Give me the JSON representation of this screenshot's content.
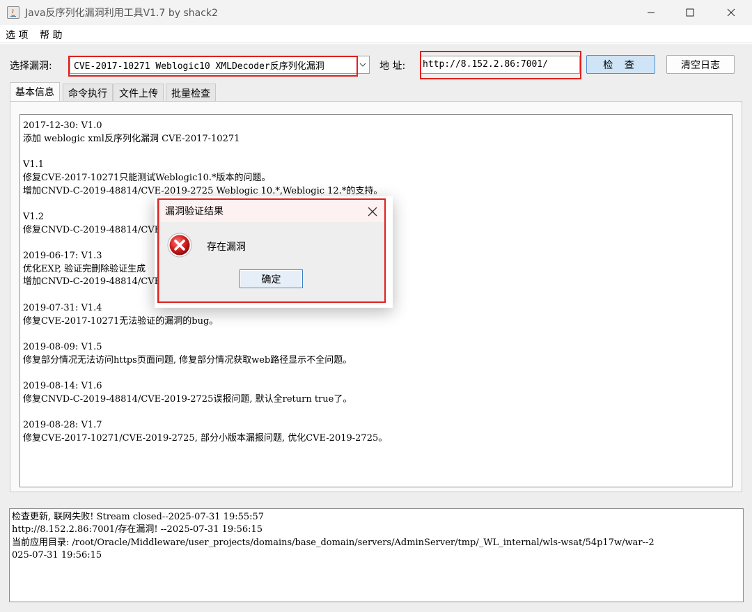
{
  "window": {
    "title": "Java反序列化漏洞利用工具V1.7 by shack2"
  },
  "menu": {
    "options": "选 项",
    "help": "帮 助"
  },
  "toolbar": {
    "vuln_label": "选择漏洞:",
    "vuln_selected": "CVE-2017-10271 Weblogic10 XMLDecoder反序列化漏洞",
    "addr_label": "地 址:",
    "addr_value": "http://8.152.2.86:7001/",
    "check_button": "检 查",
    "clear_button": "清空日志"
  },
  "tabs": [
    {
      "label": "基本信息",
      "active": true
    },
    {
      "label": "命令执行",
      "active": false
    },
    {
      "label": "文件上传",
      "active": false
    },
    {
      "label": "批量检查",
      "active": false
    }
  ],
  "info_text": "2017-12-30: V1.0\n添加 weblogic xml反序列化漏洞 CVE-2017-10271\n\nV1.1\n修复CVE-2017-10271只能测试Weblogic10.*版本的问题。\n增加CNVD-C-2019-48814/CVE-2019-2725 Weblogic 10.*,Weblogic 12.*的支持。\n\nV1.2\n修复CNVD-C-2019-48814/CVE\n\n2019-06-17: V1.3\n优化EXP, 验证完删除验证生成\n增加CNVD-C-2019-48814/CVE\n\n2019-07-31: V1.4\n修复CVE-2017-10271无法验证的漏洞的bug。\n\n2019-08-09: V1.5\n修复部分情况无法访问https页面问题, 修复部分情况获取web路径显示不全问题。\n\n2019-08-14: V1.6\n修复CNVD-C-2019-48814/CVE-2019-2725误报问题, 默认全return true了。\n\n2019-08-28: V1.7\n修复CVE-2017-10271/CVE-2019-2725, 部分小版本漏报问题, 优化CVE-2019-2725。",
  "log_text": "检查更新, 联网失败! Stream closed--2025-07-31 19:55:57\nhttp://8.152.2.86:7001/存在漏洞! --2025-07-31 19:56:15\n当前应用目录: /root/Oracle/Middleware/user_projects/domains/base_domain/servers/AdminServer/tmp/_WL_internal/wls-wsat/54p17w/war--2\n025-07-31 19:56:15",
  "dialog": {
    "title": "漏洞验证结果",
    "message": "存在漏洞",
    "ok_button": "确定",
    "icon": "error-icon"
  },
  "colors": {
    "highlight_red": "#e0201c",
    "error_red": "#d42020",
    "check_button_bg": "#cfe4f6"
  }
}
